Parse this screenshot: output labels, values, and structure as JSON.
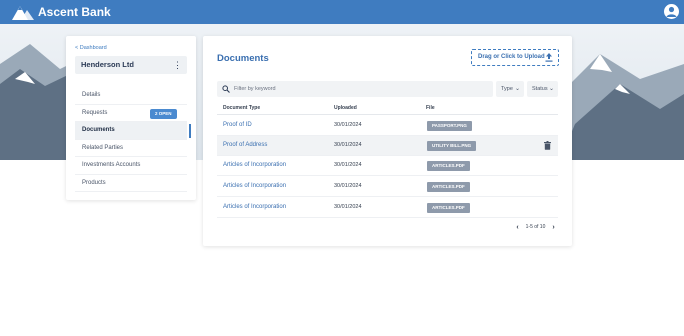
{
  "app": {
    "brand": "Ascent Bank"
  },
  "sidebar": {
    "back_label": "< Dashboard",
    "company": "Henderson Ltd",
    "menu_glyph": "⋮",
    "items": [
      {
        "label": "Details"
      },
      {
        "label": "Requests",
        "badge": "2 OPEN"
      },
      {
        "label": "Documents",
        "active": true
      },
      {
        "label": "Related Parties"
      },
      {
        "label": "Investments Accounts"
      },
      {
        "label": "Products"
      }
    ]
  },
  "main": {
    "title": "Documents",
    "upload_label": "Drag or Click to Upload",
    "search_placeholder": "Filter by keyword",
    "filters": {
      "type": "Type",
      "status": "Status"
    },
    "columns": {
      "type": "Document Type",
      "uploaded": "Uploaded",
      "file": "File"
    },
    "rows": [
      {
        "type": "Proof of ID",
        "uploaded": "30/01/2024",
        "file": "PASSPORT.PNG"
      },
      {
        "type": "Proof of Address",
        "uploaded": "30/01/2024",
        "file": "UTILITY BILL.PNG"
      },
      {
        "type": "Articles of Incorporation",
        "uploaded": "30/01/2024",
        "file": "ARTICLES.PDF"
      },
      {
        "type": "Articles of Incorporation",
        "uploaded": "30/01/2024",
        "file": "ARTICLES.PDF"
      },
      {
        "type": "Articles of Incorporation",
        "uploaded": "30/01/2024",
        "file": "ARTICLES.PDF"
      }
    ],
    "pager": {
      "text": "1-5 of 10",
      "prev": "‹",
      "next": "›"
    }
  },
  "colors": {
    "primary": "#3f7cc0",
    "chip": "#8e9aab",
    "badge": "#4a8ad0"
  },
  "icons": {
    "logo": "mountain-logo-icon",
    "user": "user-icon",
    "search": "search-icon",
    "upload": "upload-icon",
    "trash": "trash-icon"
  }
}
